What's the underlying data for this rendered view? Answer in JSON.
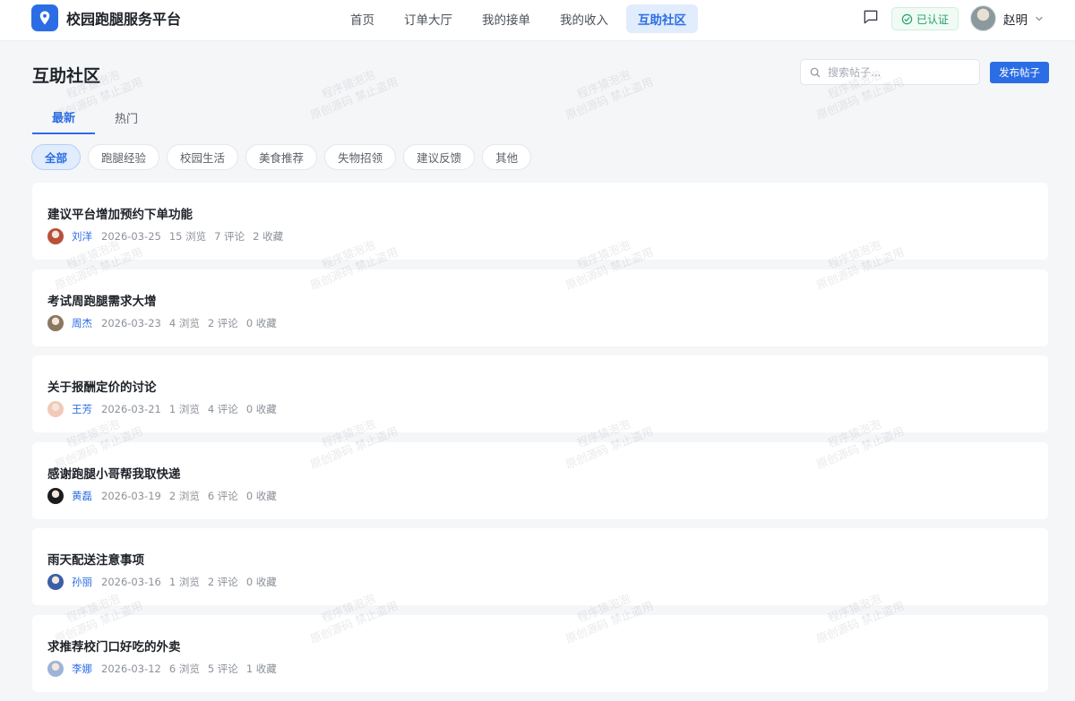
{
  "app": {
    "brand_name": "校园跑腿服务平台",
    "brand_color": "#2b6de5"
  },
  "nav": {
    "items": [
      {
        "label": "首页",
        "active": false
      },
      {
        "label": "订单大厅",
        "active": false
      },
      {
        "label": "我的接单",
        "active": false
      },
      {
        "label": "我的收入",
        "active": false
      },
      {
        "label": "互助社区",
        "active": true
      }
    ]
  },
  "header_right": {
    "message_icon": "chat-bubble-icon",
    "verify_label": "已认证",
    "user_name": "赵明"
  },
  "page": {
    "title": "互助社区",
    "search_placeholder": "搜索帖子...",
    "publish_label": "发布帖子"
  },
  "tabs": [
    {
      "label": "最新",
      "active": true
    },
    {
      "label": "热门",
      "active": false
    }
  ],
  "categories": [
    {
      "label": "全部",
      "active": true
    },
    {
      "label": "跑腿经验",
      "active": false
    },
    {
      "label": "校园生活",
      "active": false
    },
    {
      "label": "美食推荐",
      "active": false
    },
    {
      "label": "失物招领",
      "active": false
    },
    {
      "label": "建议反馈",
      "active": false
    },
    {
      "label": "其他",
      "active": false
    }
  ],
  "posts": [
    {
      "title": "建议平台增加预约下单功能",
      "author": "刘洋",
      "date": "2026-03-25",
      "views": "15 浏览",
      "comments": "7 评论",
      "favorites": "2 收藏",
      "avatar_color": "#b8503a"
    },
    {
      "title": "考试周跑腿需求大增",
      "author": "周杰",
      "date": "2026-03-23",
      "views": "4 浏览",
      "comments": "2 评论",
      "favorites": "0 收藏",
      "avatar_color": "#8b7760"
    },
    {
      "title": "关于报酬定价的讨论",
      "author": "王芳",
      "date": "2026-03-21",
      "views": "1 浏览",
      "comments": "4 评论",
      "favorites": "0 收藏",
      "avatar_color": "#f2c9b8"
    },
    {
      "title": "感谢跑腿小哥帮我取快递",
      "author": "黄磊",
      "date": "2026-03-19",
      "views": "2 浏览",
      "comments": "6 评论",
      "favorites": "0 收藏",
      "avatar_color": "#1c1c1c"
    },
    {
      "title": "雨天配送注意事项",
      "author": "孙丽",
      "date": "2026-03-16",
      "views": "1 浏览",
      "comments": "2 评论",
      "favorites": "0 收藏",
      "avatar_color": "#3a5fa8"
    },
    {
      "title": "求推荐校门口好吃的外卖",
      "author": "李娜",
      "date": "2026-03-12",
      "views": "6 浏览",
      "comments": "5 评论",
      "favorites": "1 收藏",
      "avatar_color": "#9db4d8"
    }
  ],
  "watermark": {
    "line1": "程序猿泡泡",
    "line2": "原创源码 禁止盗用"
  }
}
